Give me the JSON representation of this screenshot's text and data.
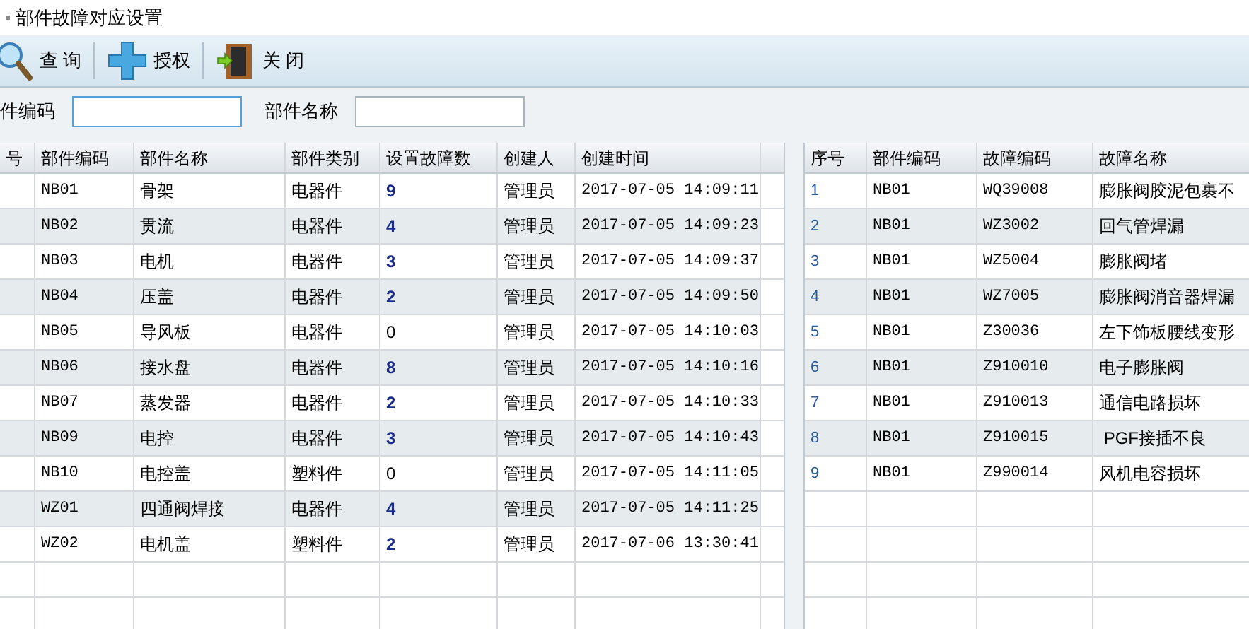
{
  "window": {
    "title": "部件故障对应设置"
  },
  "toolbar": [
    {
      "kind": "search",
      "label": "查 询"
    },
    {
      "kind": "add",
      "label": "授权"
    },
    {
      "kind": "exit",
      "label": "关 闭"
    }
  ],
  "filters": [
    {
      "label": "件编码",
      "focused": true
    },
    {
      "label": "部件名称",
      "focused": false
    }
  ],
  "parts_table": {
    "columns": [
      "号",
      "部件编码",
      "部件名称",
      "部件类别",
      "设置故障数",
      "创建人",
      "创建时间"
    ],
    "rows": [
      {
        "code": "NB01",
        "name": "骨架",
        "category": "电器件",
        "fault_count": "9",
        "emphasized": true,
        "creator": "管理员",
        "created": "2017-07-05 14:09:11"
      },
      {
        "code": "NB02",
        "name": "贯流",
        "category": "电器件",
        "fault_count": "4",
        "emphasized": true,
        "creator": "管理员",
        "created": "2017-07-05 14:09:23"
      },
      {
        "code": "NB03",
        "name": "电机",
        "category": "电器件",
        "fault_count": "3",
        "emphasized": true,
        "creator": "管理员",
        "created": "2017-07-05 14:09:37"
      },
      {
        "code": "NB04",
        "name": "压盖",
        "category": "电器件",
        "fault_count": "2",
        "emphasized": true,
        "creator": "管理员",
        "created": "2017-07-05 14:09:50"
      },
      {
        "code": "NB05",
        "name": "导风板",
        "category": "电器件",
        "fault_count": "0",
        "emphasized": false,
        "creator": "管理员",
        "created": "2017-07-05 14:10:03"
      },
      {
        "code": "NB06",
        "name": "接水盘",
        "category": "电器件",
        "fault_count": "8",
        "emphasized": true,
        "creator": "管理员",
        "created": "2017-07-05 14:10:16"
      },
      {
        "code": "NB07",
        "name": "蒸发器",
        "category": "电器件",
        "fault_count": "2",
        "emphasized": true,
        "creator": "管理员",
        "created": "2017-07-05 14:10:33"
      },
      {
        "code": "NB09",
        "name": "电控",
        "category": "电器件",
        "fault_count": "3",
        "emphasized": true,
        "creator": "管理员",
        "created": "2017-07-05 14:10:43"
      },
      {
        "code": "NB10",
        "name": "电控盖",
        "category": "塑料件",
        "fault_count": "0",
        "emphasized": false,
        "creator": "管理员",
        "created": "2017-07-05 14:11:05"
      },
      {
        "code": "WZ01",
        "name": "四通阀焊接",
        "category": "电器件",
        "fault_count": "4",
        "emphasized": true,
        "creator": "管理员",
        "created": "2017-07-05 14:11:25"
      },
      {
        "code": "WZ02",
        "name": "电机盖",
        "category": "塑料件",
        "fault_count": "2",
        "emphasized": true,
        "creator": "管理员",
        "created": "2017-07-06 13:30:41"
      }
    ]
  },
  "faults_table": {
    "columns": [
      "序号",
      "部件编码",
      "故障编码",
      "故障名称"
    ],
    "rows": [
      {
        "no": "1",
        "part_code": "NB01",
        "fault_code": "WQ39008",
        "fault_name": "膨胀阀胶泥包裹不"
      },
      {
        "no": "2",
        "part_code": "NB01",
        "fault_code": "WZ3002",
        "fault_name": "回气管焊漏"
      },
      {
        "no": "3",
        "part_code": "NB01",
        "fault_code": "WZ5004",
        "fault_name": "膨胀阀堵"
      },
      {
        "no": "4",
        "part_code": "NB01",
        "fault_code": "WZ7005",
        "fault_name": "膨胀阀消音器焊漏"
      },
      {
        "no": "5",
        "part_code": "NB01",
        "fault_code": "Z30036",
        "fault_name": "左下饰板腰线变形"
      },
      {
        "no": "6",
        "part_code": "NB01",
        "fault_code": "Z910010",
        "fault_name": "电子膨胀阀"
      },
      {
        "no": "7",
        "part_code": "NB01",
        "fault_code": "Z910013",
        "fault_name": "通信电路损坏"
      },
      {
        "no": "8",
        "part_code": "NB01",
        "fault_code": "Z910015",
        "fault_name": " PGF接插不良"
      },
      {
        "no": "9",
        "part_code": "NB01",
        "fault_code": "Z990014",
        "fault_name": "风机电容损坏"
      }
    ]
  }
}
